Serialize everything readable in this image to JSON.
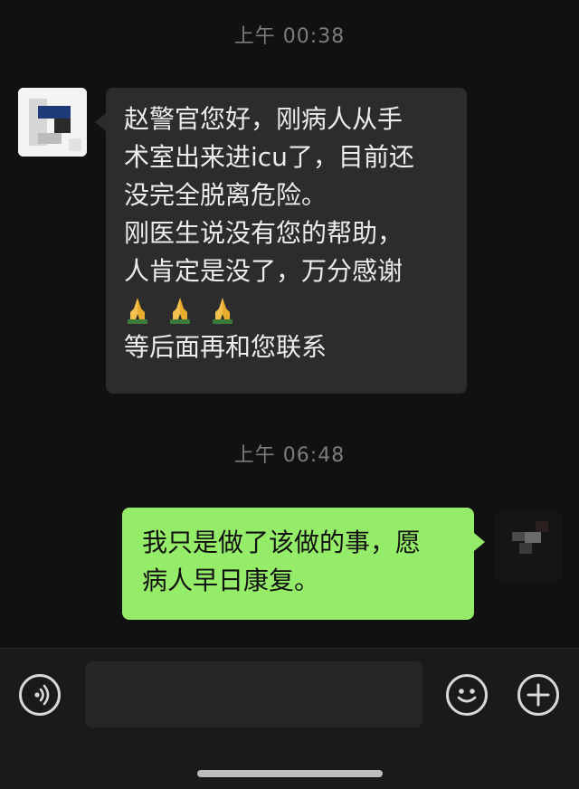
{
  "chat": {
    "messages": [
      {
        "timestamp": "上午 00:38",
        "direction": "incoming",
        "lines": [
          "赵警官您好，刚病人从手",
          "术室出来进icu了，目前还",
          "没完全脱离危险。",
          "刚医生说没有您的帮助，",
          "人肯定是没了，万分感谢"
        ],
        "emoji": [
          "folded-hands",
          "folded-hands",
          "folded-hands"
        ],
        "after_emoji": "等后面再和您联系"
      },
      {
        "timestamp": "上午 06:48",
        "direction": "outgoing",
        "lines": [
          "我只是做了该做的事，愿",
          "病人早日康复。"
        ]
      }
    ]
  },
  "input_bar": {
    "left_icon": "voice-icon",
    "right_icons": [
      "emoji-icon",
      "plus-icon"
    ]
  },
  "colors": {
    "background": "#111111",
    "incoming_bubble": "#2c2c2c",
    "outgoing_bubble": "#95ec69"
  }
}
